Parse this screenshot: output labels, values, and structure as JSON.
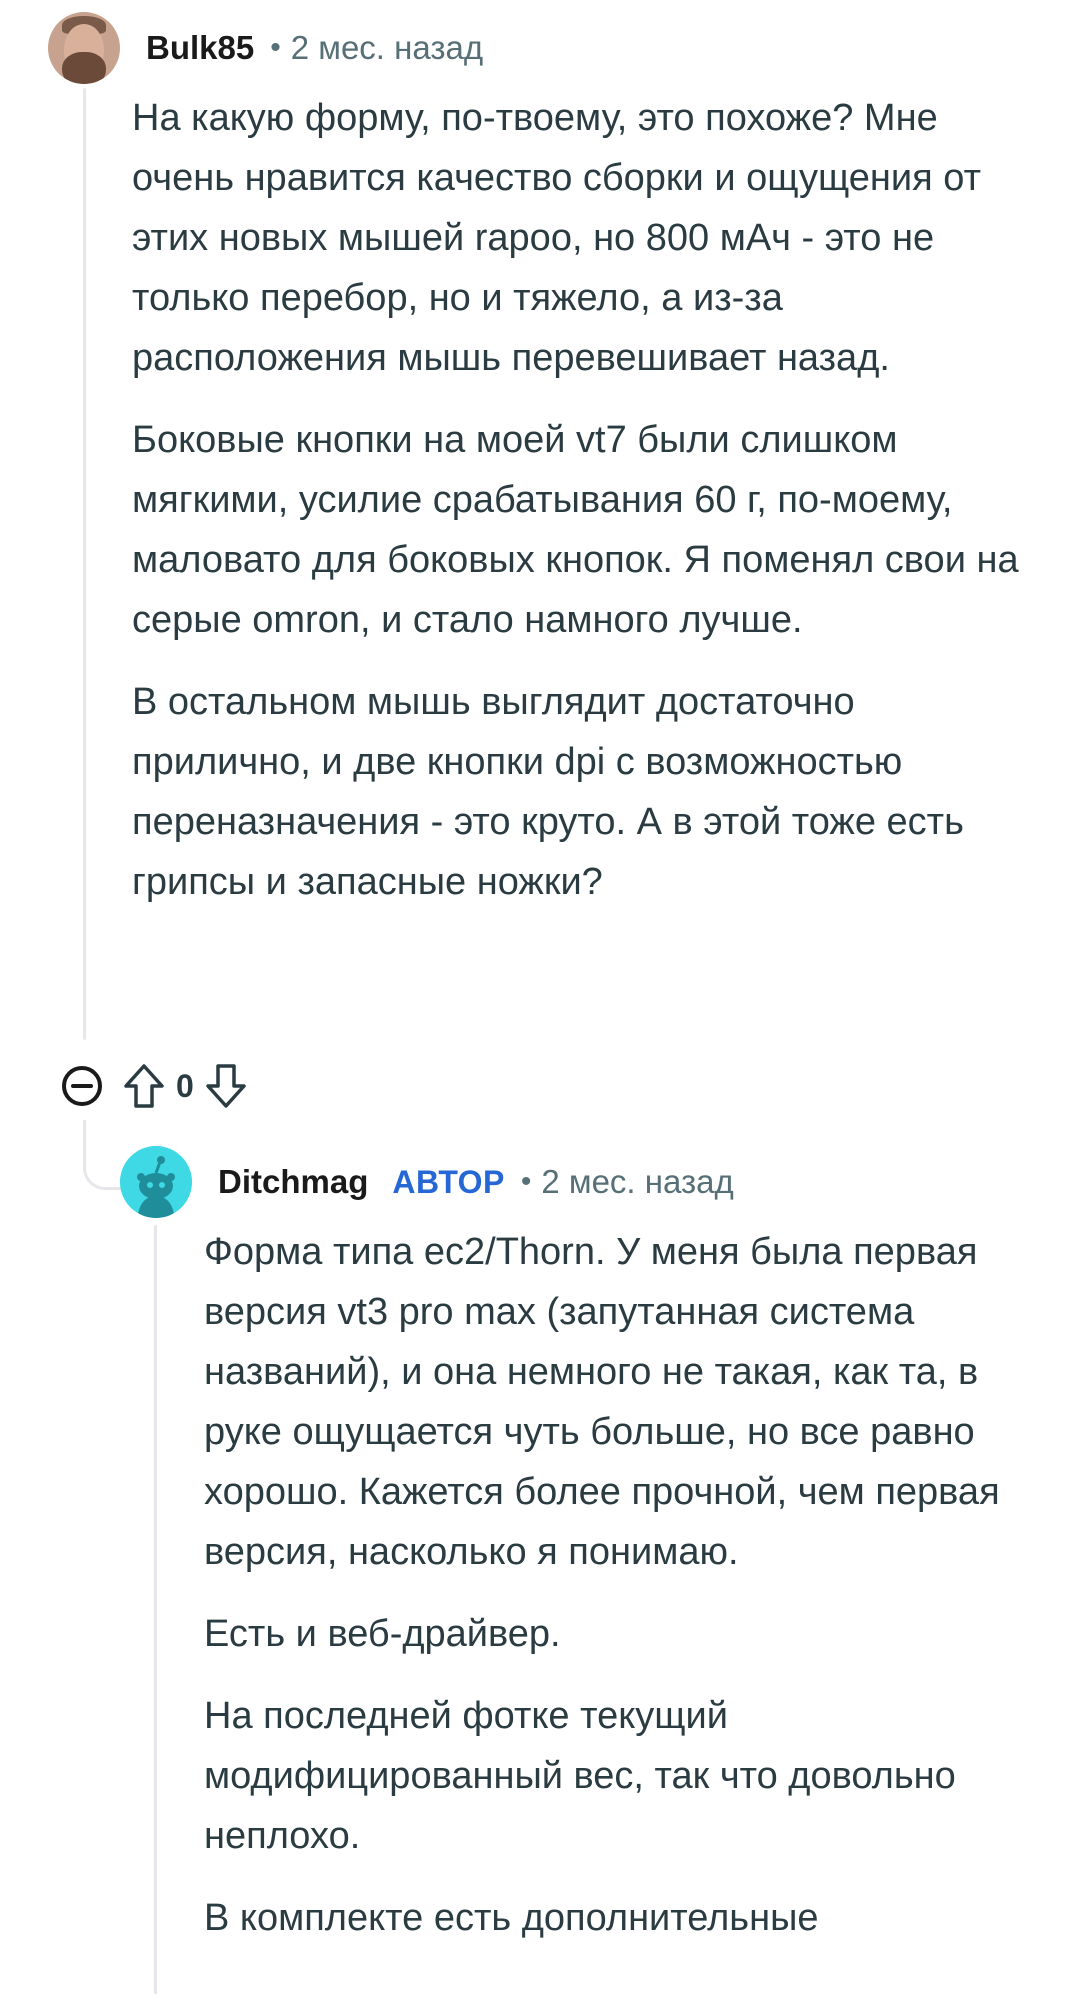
{
  "comment1": {
    "username": "Bulk85",
    "time": "2 мес. назад",
    "paragraphs": [
      "На какую форму, по-твоему, это похоже? Мне очень нравится качество сборки и ощущения от этих новых мышей rapoo, но 800 мАч - это не только перебор, но и тяжело, а из-за расположения мышь перевешивает назад.",
      "Боковые кнопки на моей vt7 были слишком мягкими, усилие срабатывания 60 г, по-моему, маловато для боковых кнопок. Я поменял свои на серые omron, и стало намного лучше.",
      "В остальном мышь выглядит достаточно прилично, и две кнопки dpi с возможностью переназначения - это круто. А в этой тоже есть грипсы и запасные ножки?"
    ],
    "vote_count": "0",
    "icons": {
      "collapse": "collapse-minus-icon",
      "upvote": "upvote-arrow-icon",
      "downvote": "downvote-arrow-icon"
    }
  },
  "comment2": {
    "username": "Ditchmag",
    "badge": "АВТОР",
    "time": "2 мес. назад",
    "paragraphs": [
      "Форма типа ec2/Thorn. У меня была первая версия vt3 pro max (запутанная система названий), и она немного не такая, как та, в руке ощущается чуть больше, но все равно хорошо. Кажется более прочной, чем первая версия, насколько я понимаю.",
      "Есть и веб-драйвер.",
      "На последней фотке текущий модифицированный вес, так что довольно неплохо.",
      "В комплекте есть дополнительные"
    ]
  },
  "colors": {
    "author_badge": "#2667d6",
    "meta_text": "#576f76",
    "thread_line": "#e5e7ea",
    "avatar_teal": "#3fd9e6"
  }
}
